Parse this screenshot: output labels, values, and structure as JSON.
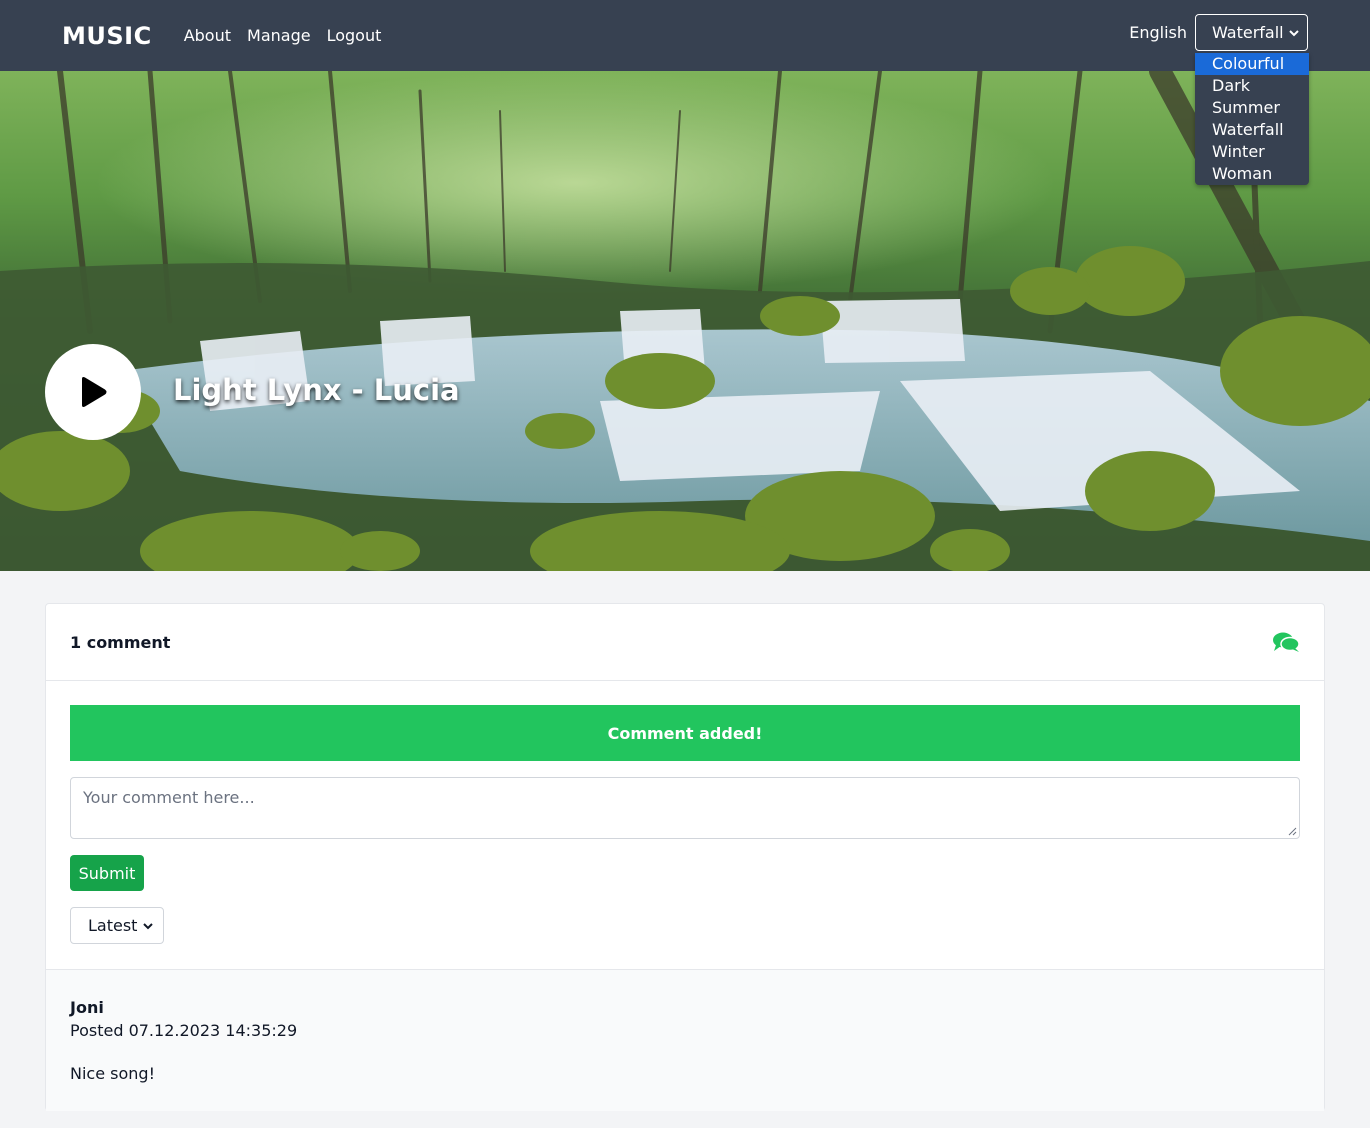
{
  "header": {
    "brand": "MUSIC",
    "nav": [
      "About",
      "Manage",
      "Logout"
    ],
    "language": "English",
    "theme_selected": "Waterfall",
    "theme_options": [
      "Colourful",
      "Dark",
      "Summer",
      "Waterfall",
      "Winter",
      "Woman"
    ],
    "highlighted_option": "Colourful"
  },
  "hero": {
    "song_title": "Light Lynx - Lucia",
    "play_icon": "play-icon"
  },
  "comments": {
    "count_label": "1 comment",
    "header_icon": "comments-icon",
    "alert": "Comment added!",
    "input_placeholder": "Your comment here...",
    "submit_label": "Submit",
    "sort_selected": "Latest",
    "items": [
      {
        "author": "Joni",
        "posted": "Posted 07.12.2023 14:35:29",
        "text": "Nice song!"
      }
    ]
  },
  "colors": {
    "header_bg": "#374151",
    "accent_green": "#22c55e",
    "submit_green": "#16a34a",
    "option_highlight": "#1a6ad8"
  }
}
